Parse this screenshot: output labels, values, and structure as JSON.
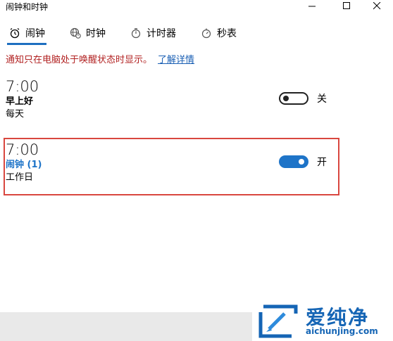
{
  "window": {
    "title": "闹钟和时钟"
  },
  "tabs": [
    {
      "label": "闹钟",
      "icon": "alarm-icon",
      "active": true
    },
    {
      "label": "时钟",
      "icon": "world-clock-icon",
      "active": false
    },
    {
      "label": "计时器",
      "icon": "timer-icon",
      "active": false
    },
    {
      "label": "秒表",
      "icon": "stopwatch-icon",
      "active": false
    }
  ],
  "notice": {
    "text": "通知只在电脑处于唤醒状态时显示。",
    "link": "了解详情"
  },
  "alarms": [
    {
      "time": "7:00",
      "name": "早上好",
      "repeat": "每天",
      "state_label": "关",
      "enabled": false
    },
    {
      "time": "7:00",
      "name": "闹钟 (1)",
      "repeat": "工作日",
      "state_label": "开",
      "enabled": true
    }
  ],
  "watermark": {
    "brand": "爱纯净",
    "url": "aichunjing.com"
  },
  "colors": {
    "accent": "#1e74c8",
    "notice": "#b22222",
    "highlight_frame": "#d9473f"
  }
}
